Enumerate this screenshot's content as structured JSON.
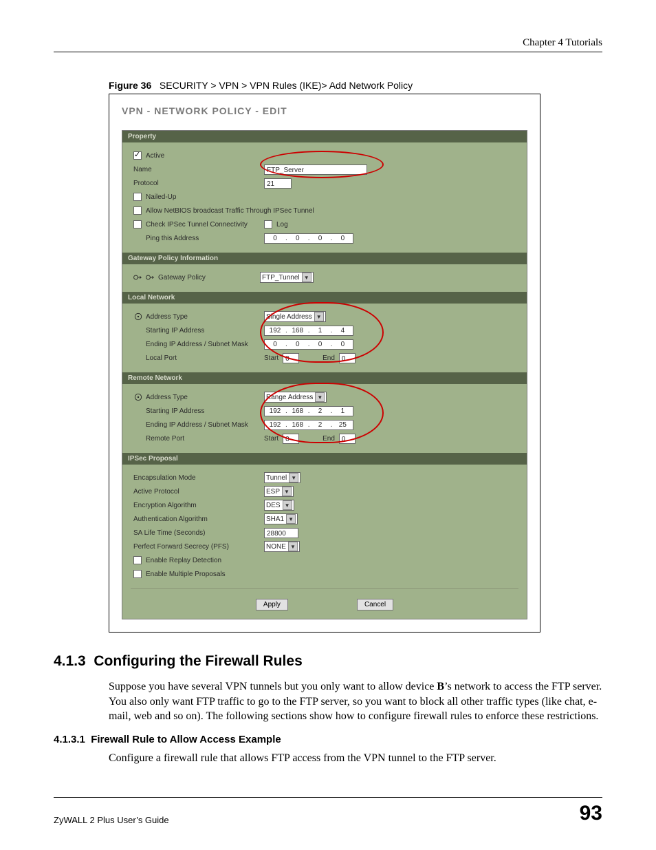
{
  "header": {
    "chapter": "Chapter 4 Tutorials"
  },
  "figure": {
    "label": "Figure 36",
    "caption": "SECURITY > VPN > VPN Rules (IKE)> Add Network Policy",
    "panel_title": "VPN - NETWORK POLICY - EDIT",
    "sections": {
      "property": {
        "bar": "Property",
        "active_label": "Active",
        "name_label": "Name",
        "name_value": "FTP_Server",
        "protocol_label": "Protocol",
        "protocol_value": "21",
        "nailed_label": "Nailed-Up",
        "netbios_label": "Allow NetBIOS broadcast Traffic Through IPSec Tunnel",
        "check_conn_label": "Check IPSec Tunnel Connectivity",
        "log_label": "Log",
        "ping_label": "Ping this Address",
        "ping_ip": [
          "0",
          "0",
          "0",
          "0"
        ]
      },
      "gpi": {
        "bar": "Gateway Policy Information",
        "label": "Gateway Policy",
        "value": "FTP_Tunnel"
      },
      "local": {
        "bar": "Local Network",
        "addr_type_label": "Address Type",
        "addr_type_value": "Single Address",
        "start_label": "Starting IP Address",
        "start_ip": [
          "192",
          "168",
          "1",
          "4"
        ],
        "end_label": "Ending IP Address / Subnet Mask",
        "end_ip": [
          "0",
          "0",
          "0",
          "0"
        ],
        "port_label": "Local Port",
        "start_word": "Start",
        "end_word": "End",
        "port_start": "0",
        "port_end": "0"
      },
      "remote": {
        "bar": "Remote Network",
        "addr_type_label": "Address Type",
        "addr_type_value": "Range Address",
        "start_label": "Starting IP Address",
        "start_ip": [
          "192",
          "168",
          "2",
          "1"
        ],
        "end_label": "Ending IP Address / Subnet Mask",
        "end_ip": [
          "192",
          "168",
          "2",
          "25"
        ],
        "port_label": "Remote Port",
        "start_word": "Start",
        "end_word": "End",
        "port_start": "0",
        "port_end": "0"
      },
      "ipsec": {
        "bar": "IPSec Proposal",
        "encap_label": "Encapsulation Mode",
        "encap_value": "Tunnel",
        "proto_label": "Active Protocol",
        "proto_value": "ESP",
        "enc_label": "Encryption Algorithm",
        "enc_value": "DES",
        "auth_label": "Authentication Algorithm",
        "auth_value": "SHA1",
        "sa_label": "SA Life Time (Seconds)",
        "sa_value": "28800",
        "pfs_label": "Perfect Forward Secrecy (PFS)",
        "pfs_value": "NONE",
        "replay_label": "Enable Replay Detection",
        "multi_label": "Enable Multiple Proposals"
      }
    },
    "buttons": {
      "apply": "Apply",
      "cancel": "Cancel"
    }
  },
  "body": {
    "h2_num": "4.1.3",
    "h2_title": "Configuring the Firewall Rules",
    "p1_a": "Suppose you have several VPN tunnels but you only want to allow device ",
    "p1_b": "B",
    "p1_c": "’s network to access the FTP server. You also only want FTP traffic to go to the FTP server, so you want to block all other traffic types (like chat, e-mail, web and so on). The following sections show how to configure firewall rules to enforce these restrictions.",
    "h3_num": "4.1.3.1",
    "h3_title": "Firewall Rule to Allow Access Example",
    "p2": "Configure a firewall rule that allows FTP access from the VPN tunnel to the FTP server."
  },
  "footer": {
    "guide": "ZyWALL 2 Plus User’s Guide",
    "page": "93"
  }
}
